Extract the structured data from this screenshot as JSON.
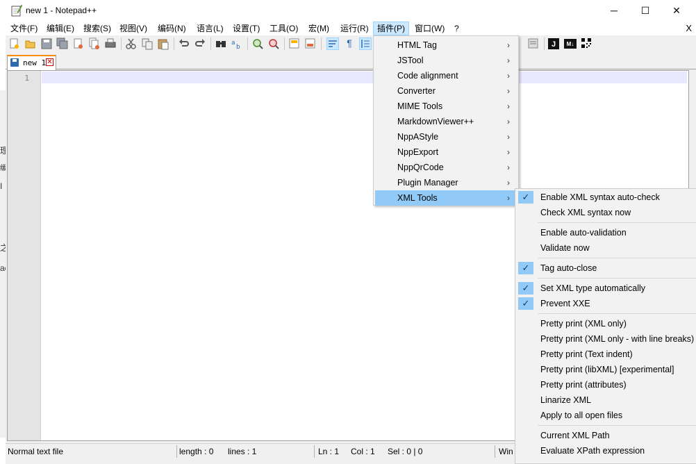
{
  "window": {
    "title": "new 1 - Notepad++",
    "buttons": {
      "minimize": "─",
      "maximize": "☐",
      "close": "✕"
    }
  },
  "menubar": {
    "items": [
      {
        "label": "文件(F)"
      },
      {
        "label": "编辑(E)"
      },
      {
        "label": "搜索(S)"
      },
      {
        "label": "视图(V)"
      },
      {
        "label": "编码(N)"
      },
      {
        "label": "语言(L)"
      },
      {
        "label": "设置(T)"
      },
      {
        "label": "工具(O)"
      },
      {
        "label": "宏(M)"
      },
      {
        "label": "运行(R)"
      },
      {
        "label": "插件(P)"
      },
      {
        "label": "窗口(W)"
      },
      {
        "label": "?"
      }
    ],
    "active": "插件(P)",
    "close_doc": "X"
  },
  "toolbar": {
    "icons": [
      "new-file-icon",
      "open-file-icon",
      "save-icon",
      "save-all-icon",
      "close-icon",
      "close-all-icon",
      "print-icon",
      "cut-icon",
      "copy-icon",
      "paste-icon",
      "undo-icon",
      "redo-icon",
      "find-icon",
      "replace-icon",
      "zoom-in-icon",
      "zoom-out-icon",
      "sync-vertical-icon",
      "sync-horizontal-icon",
      "word-wrap-icon",
      "show-all-chars-icon",
      "indent-guide-icon",
      "jstool-icon",
      "markdown-icon",
      "qrcode-icon"
    ],
    "j_badge": "J",
    "md_badge": "M↓"
  },
  "tabs": [
    {
      "label": "new 1",
      "close": "✕"
    }
  ],
  "editor": {
    "line_numbers": [
      "1"
    ]
  },
  "statusbar": {
    "file_type": "Normal text file",
    "length": "length : 0",
    "lines": "lines : 1",
    "ln": "Ln : 1",
    "col": "Col : 1",
    "sel": "Sel : 0 | 0",
    "eol": "Win"
  },
  "plugins_menu": {
    "items": [
      {
        "label": "HTML Tag"
      },
      {
        "label": "JSTool"
      },
      {
        "label": "Code alignment"
      },
      {
        "label": "Converter"
      },
      {
        "label": "MIME Tools"
      },
      {
        "label": "MarkdownViewer++"
      },
      {
        "label": "NppAStyle"
      },
      {
        "label": "NppExport"
      },
      {
        "label": "NppQrCode"
      },
      {
        "label": "Plugin Manager"
      },
      {
        "label": "XML Tools"
      }
    ],
    "highlighted": "XML Tools",
    "submenu_arrow": "›"
  },
  "xml_tools_menu": {
    "groups": [
      [
        {
          "label": "Enable XML syntax auto-check",
          "checked": true
        },
        {
          "label": "Check XML syntax now",
          "checked": false
        }
      ],
      [
        {
          "label": "Enable auto-validation",
          "checked": false
        },
        {
          "label": "Validate now",
          "checked": false
        }
      ],
      [
        {
          "label": "Tag auto-close",
          "checked": true
        }
      ],
      [
        {
          "label": "Set XML type automatically",
          "checked": true
        },
        {
          "label": "Prevent XXE",
          "checked": true
        }
      ],
      [
        {
          "label": "Pretty print (XML only)",
          "checked": false
        },
        {
          "label": "Pretty print (XML only - with line breaks)",
          "checked": false
        },
        {
          "label": "Pretty print (Text indent)",
          "checked": false
        },
        {
          "label": "Pretty print (libXML) [experimental]",
          "checked": false
        },
        {
          "label": "Pretty print (attributes)",
          "checked": false
        },
        {
          "label": "Linarize XML",
          "checked": false
        },
        {
          "label": "Apply to all open files",
          "checked": false
        }
      ],
      [
        {
          "label": "Current XML Path",
          "checked": false
        },
        {
          "label": "Evaluate XPath expression",
          "checked": false
        }
      ]
    ],
    "check_mark": "✓"
  },
  "background": {
    "fragments": [
      "理",
      "缓",
      "I",
      "之",
      "ad"
    ]
  },
  "colors": {
    "menu_highlight": "#91c9f7",
    "tab_accent": "#fa8c00",
    "current_line": "#e8e8ff"
  }
}
